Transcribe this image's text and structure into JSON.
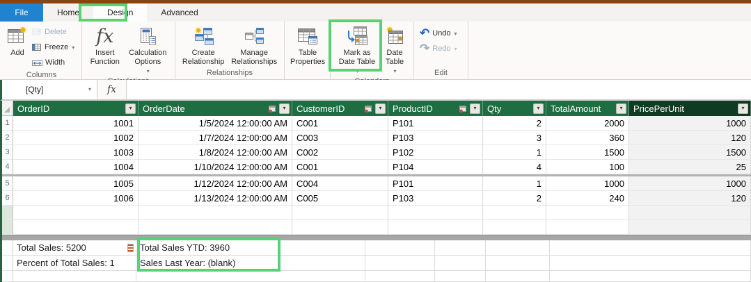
{
  "tabs": {
    "file": "File",
    "home": "Home",
    "design": "Design",
    "advanced": "Advanced"
  },
  "ribbon": {
    "columns": {
      "label": "Columns",
      "add": "Add",
      "delete": "Delete",
      "freeze": "Freeze",
      "width": "Width"
    },
    "calculations": {
      "label": "Calculations",
      "insert_function": "Insert Function",
      "calculation_options": "Calculation Options"
    },
    "relationships": {
      "label": "Relationships",
      "create": "Create Relationship",
      "manage": "Manage Relationships"
    },
    "properties": {
      "table_properties": "Table Properties"
    },
    "calendars": {
      "label": "Calendars",
      "mark_as_date_table": "Mark as Date Table",
      "date_table": "Date Table"
    },
    "edit": {
      "label": "Edit",
      "undo": "Undo",
      "redo": "Redo"
    }
  },
  "formula_bar": {
    "name_box": "[Qty]",
    "fx_label": "fx",
    "formula": ""
  },
  "grid": {
    "headers": [
      "OrderID",
      "OrderDate",
      "CustomerID",
      "ProductID",
      "Qty",
      "TotalAmount",
      "PricePerUnit"
    ],
    "row_numbers": [
      "1",
      "2",
      "3",
      "4",
      "5",
      "6"
    ],
    "rows": [
      [
        "1001",
        "1/5/2024 12:00:00 AM",
        "C001",
        "P101",
        "2",
        "2000",
        "1000"
      ],
      [
        "1002",
        "1/7/2024 12:00:00 AM",
        "C003",
        "P103",
        "3",
        "360",
        "120"
      ],
      [
        "1003",
        "1/8/2024 12:00:00 AM",
        "C002",
        "P102",
        "1",
        "1500",
        "1500"
      ],
      [
        "1004",
        "1/10/2024 12:00:00 AM",
        "C001",
        "P104",
        "4",
        "100",
        "25"
      ],
      [
        "1005",
        "1/12/2024 12:00:00 AM",
        "C004",
        "P101",
        "1",
        "1000",
        "1000"
      ],
      [
        "1006",
        "1/13/2024 12:00:00 AM",
        "C005",
        "P103",
        "2",
        "240",
        "120"
      ]
    ]
  },
  "measures": {
    "total_sales": "Total Sales: 5200",
    "total_sales_ytd": "Total Sales YTD: 3960",
    "percent_of_total": "Percent of Total Sales: 1",
    "sales_last_year": "Sales Last Year: (blank)"
  },
  "colors": {
    "highlight_green": "#57d374",
    "header_green": "#1e6e41",
    "selected_header_green": "#113a22",
    "title_bar_brown": "#8a4410",
    "file_tab_blue": "#1f83d1"
  }
}
